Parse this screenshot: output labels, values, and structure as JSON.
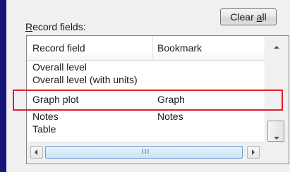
{
  "clear_all_button": {
    "prefix": "Clear ",
    "mnemonic": "a",
    "suffix": "ll"
  },
  "record_fields_label": {
    "mnemonic": "R",
    "rest": "ecord fields:"
  },
  "table": {
    "columns": [
      "Record field",
      "Bookmark"
    ],
    "rows": [
      {
        "field": "Overall level",
        "bookmark": ""
      },
      {
        "field": "Overall level (with units)",
        "bookmark": ""
      },
      {
        "field": "Graph plot",
        "bookmark": "Graph"
      },
      {
        "field": "Notes",
        "bookmark": "Notes"
      },
      {
        "field": "Table",
        "bookmark": ""
      }
    ],
    "highlighted_row_index": 2
  },
  "scrollbar": {
    "horizontal_grip": "III"
  },
  "colors": {
    "highlight_border": "#e41c2c",
    "left_bar": "#15157a",
    "scroll_thumb": "#c8e1f7"
  }
}
